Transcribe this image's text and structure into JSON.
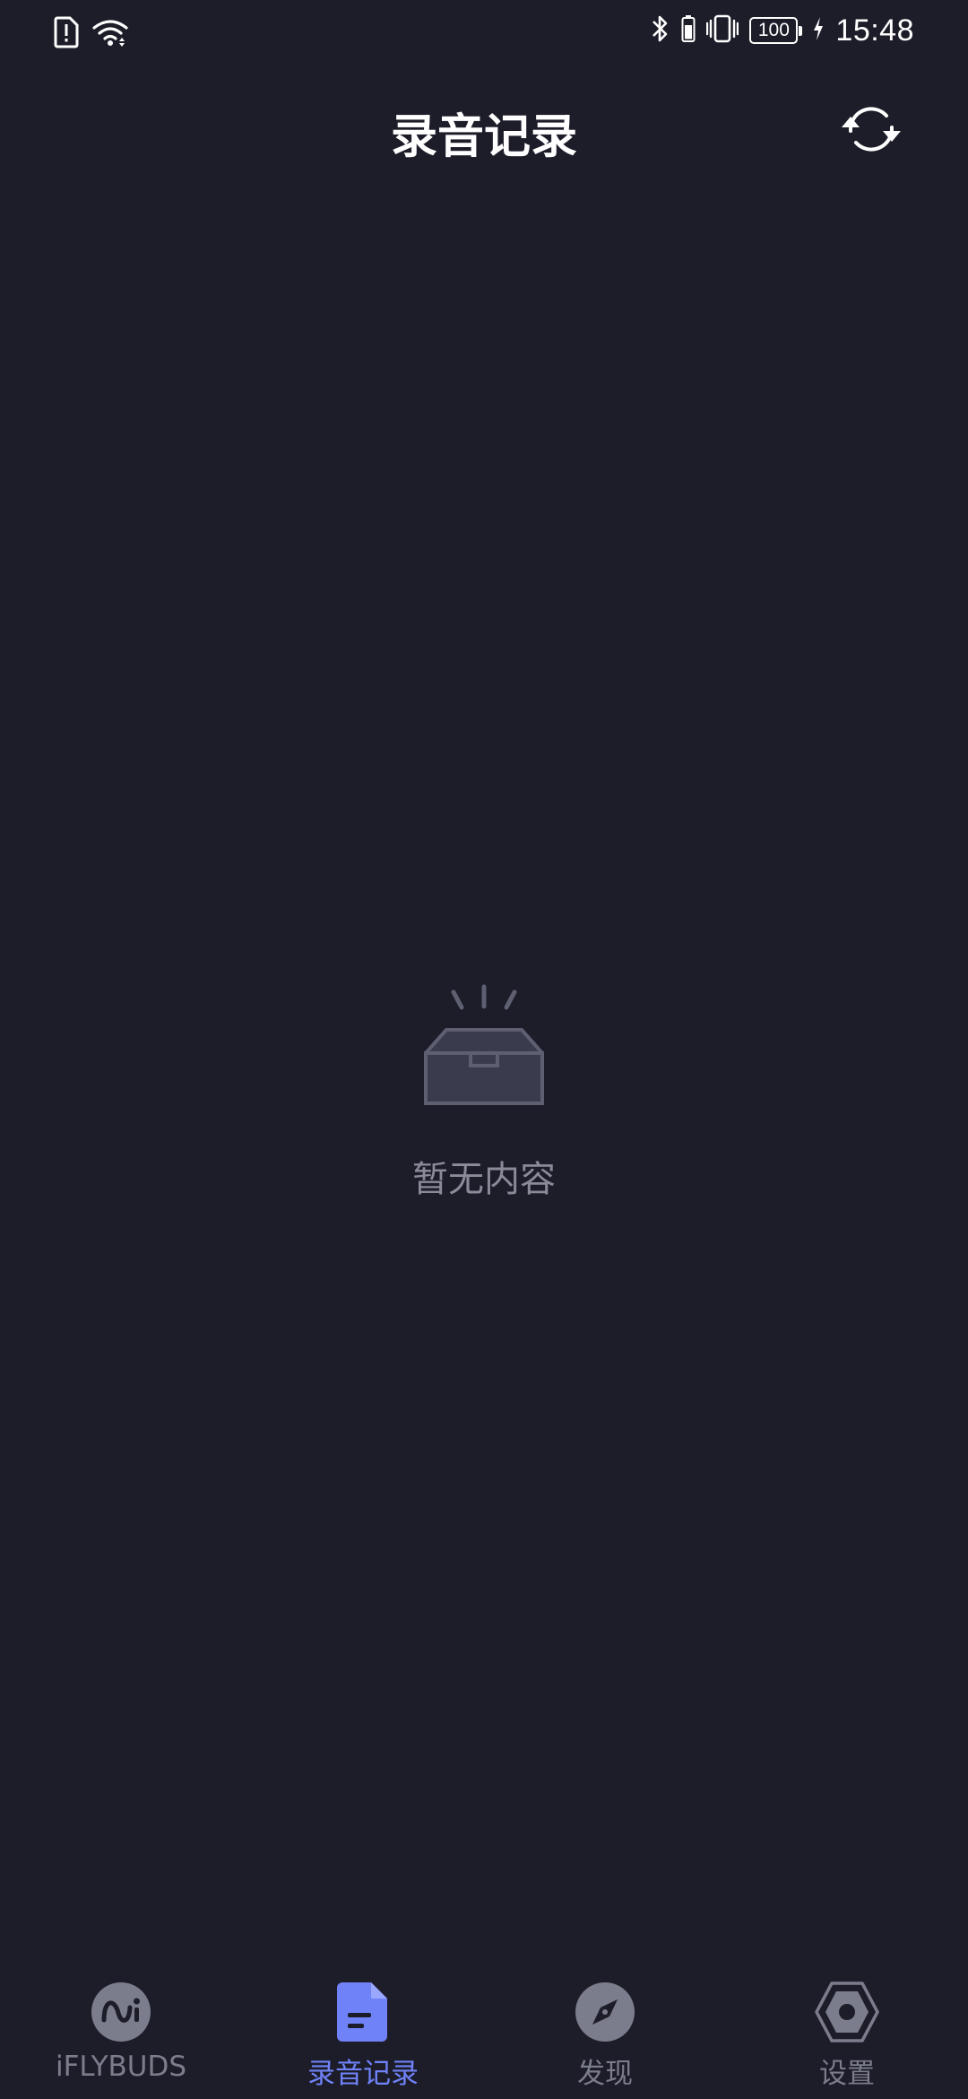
{
  "status_bar": {
    "time": "15:48",
    "battery": "100",
    "icons": [
      "sim-alert-icon",
      "wifi-icon",
      "bluetooth-icon",
      "vibrate-icon",
      "battery-icon",
      "charging-icon"
    ]
  },
  "header": {
    "title": "录音记录",
    "sync_icon": "sync-icon"
  },
  "empty_state": {
    "icon": "empty-inbox-icon",
    "text": "暂无内容"
  },
  "bottom_nav": {
    "items": [
      {
        "label": "iFLYBUDS",
        "icon": "iflybuds-icon",
        "active": false
      },
      {
        "label": "录音记录",
        "icon": "document-icon",
        "active": true
      },
      {
        "label": "发现",
        "icon": "compass-icon",
        "active": false
      },
      {
        "label": "设置",
        "icon": "settings-hexagon-icon",
        "active": false
      }
    ]
  },
  "colors": {
    "background": "#1c1d29",
    "accent": "#6f82f7",
    "inactive": "#7c7d8c",
    "empty_text": "#8a8b99"
  }
}
